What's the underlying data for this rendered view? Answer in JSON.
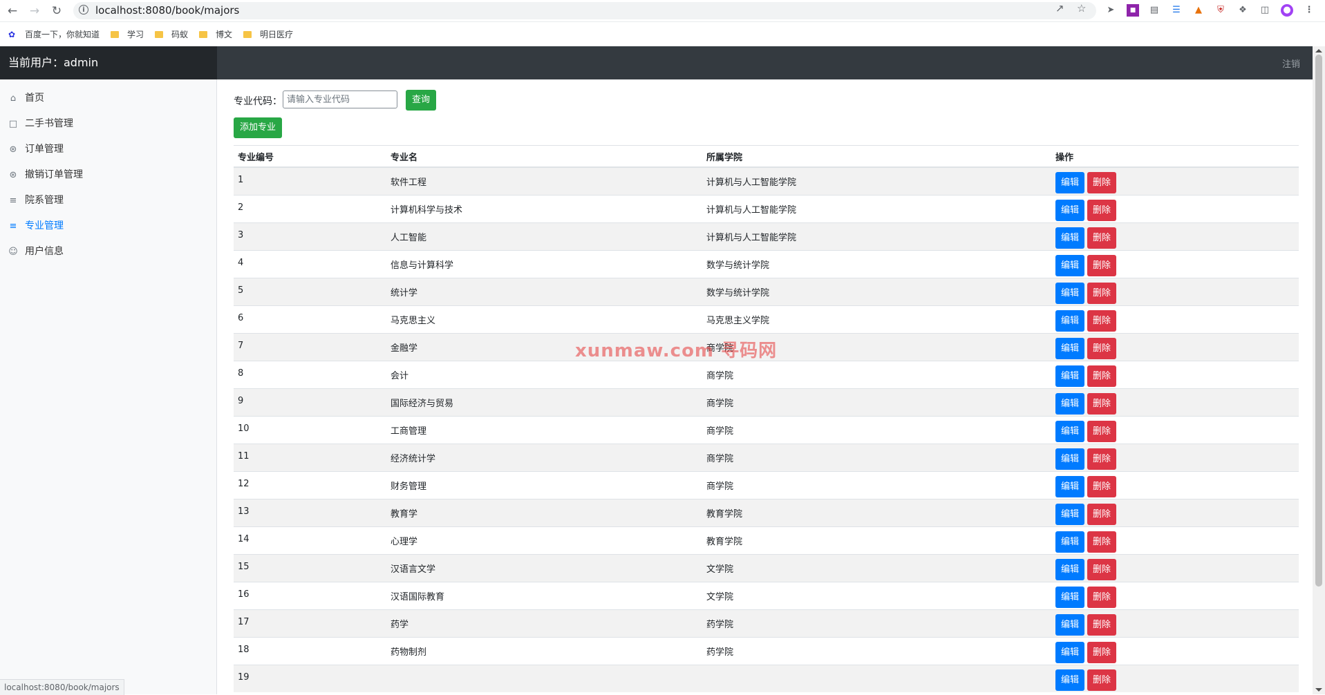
{
  "browser": {
    "url": "localhost:8080/book/majors",
    "bookmarks": [
      "百度一下，你就知道",
      "学习",
      "码蚁",
      "博文",
      "明日医疗"
    ]
  },
  "header": {
    "current_user": "当前用户：admin",
    "logout": "注销"
  },
  "sidebar": {
    "items": [
      {
        "label": "首页",
        "icon": "home-icon"
      },
      {
        "label": "二手书管理",
        "icon": "file-icon"
      },
      {
        "label": "订单管理",
        "icon": "cart-icon"
      },
      {
        "label": "撤销订单管理",
        "icon": "cart-icon"
      },
      {
        "label": "院系管理",
        "icon": "layers-icon"
      },
      {
        "label": "专业管理",
        "icon": "layers-icon",
        "active": true
      },
      {
        "label": "用户信息",
        "icon": "users-icon"
      }
    ]
  },
  "search": {
    "label": "专业代码：",
    "placeholder": "请输入专业代码",
    "value": "",
    "button": "查询"
  },
  "add_button": "添加专业",
  "table": {
    "headers": [
      "专业编号",
      "专业名",
      "所属学院",
      "操作"
    ],
    "edit_label": "编辑",
    "delete_label": "删除",
    "rows": [
      {
        "id": "1",
        "name": "软件工程",
        "college": "计算机与人工智能学院"
      },
      {
        "id": "2",
        "name": "计算机科学与技术",
        "college": "计算机与人工智能学院"
      },
      {
        "id": "3",
        "name": "人工智能",
        "college": "计算机与人工智能学院"
      },
      {
        "id": "4",
        "name": "信息与计算科学",
        "college": "数学与统计学院"
      },
      {
        "id": "5",
        "name": "统计学",
        "college": "数学与统计学院"
      },
      {
        "id": "6",
        "name": "马克思主义",
        "college": "马克思主义学院"
      },
      {
        "id": "7",
        "name": "金融学",
        "college": "商学院"
      },
      {
        "id": "8",
        "name": "会计",
        "college": "商学院"
      },
      {
        "id": "9",
        "name": "国际经济与贸易",
        "college": "商学院"
      },
      {
        "id": "10",
        "name": "工商管理",
        "college": "商学院"
      },
      {
        "id": "11",
        "name": "经济统计学",
        "college": "商学院"
      },
      {
        "id": "12",
        "name": "财务管理",
        "college": "商学院"
      },
      {
        "id": "13",
        "name": "教育学",
        "college": "教育学院"
      },
      {
        "id": "14",
        "name": "心理学",
        "college": "教育学院"
      },
      {
        "id": "15",
        "name": "汉语言文学",
        "college": "文学院"
      },
      {
        "id": "16",
        "name": "汉语国际教育",
        "college": "文学院"
      },
      {
        "id": "17",
        "name": "药学",
        "college": "药学院"
      },
      {
        "id": "18",
        "name": "药物制剂",
        "college": "药学院"
      },
      {
        "id": "19",
        "name": "",
        "college": ""
      }
    ]
  },
  "watermark": "xunmaw.com 寻码网",
  "status_bar_url": "localhost:8080/book/majors",
  "colors": {
    "header_bg": "#343a40",
    "brand_bg": "#23272b",
    "primary": "#007bff",
    "success": "#28a745",
    "danger": "#dc3545"
  }
}
